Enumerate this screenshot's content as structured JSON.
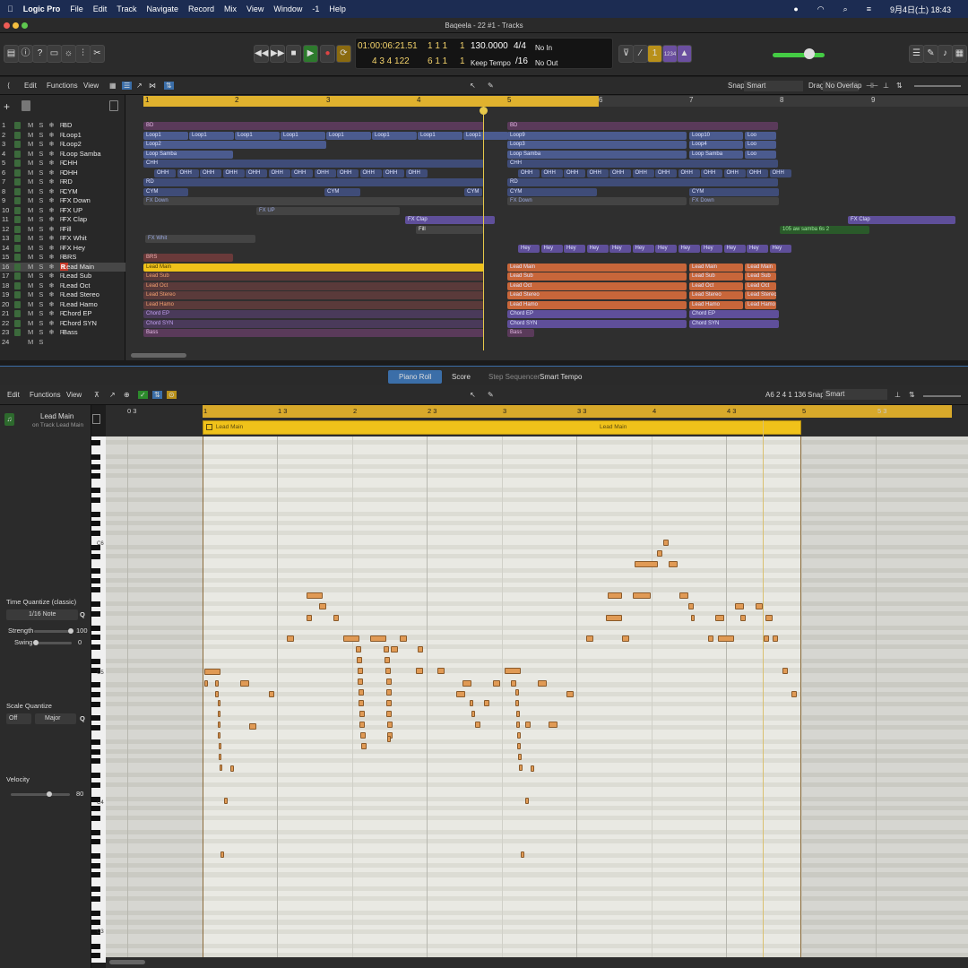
{
  "menubar": {
    "apple": "",
    "items": [
      "Logic Pro",
      "File",
      "Edit",
      "Track",
      "Navigate",
      "Record",
      "Mix",
      "View",
      "Window",
      "?1",
      "Help"
    ],
    "clock": "9月4日(土) 18:43"
  },
  "window": {
    "title": "Baqeela - 22 #1 - Tracks"
  },
  "lcd": {
    "time": "01:00:06:21.51",
    "beats_top": "1  1  1",
    "beats_top_last": "1",
    "beats_bottom": "4  3  4 122",
    "beats_bottom2": "6  1  1",
    "beats_bottom_last": "1",
    "tempo": "130.0000",
    "tempo_mode": "Keep Tempo",
    "signature": "4/4",
    "division": "/16",
    "in": "No In",
    "out": "No Out"
  },
  "tracks_toolbar": {
    "edit": "Edit",
    "functions": "Functions",
    "view": "View",
    "snap_label": "Snap:",
    "snap_value": "Smart",
    "drag_label": "Drag:",
    "drag_value": "No Overlap"
  },
  "ruler_bars": [
    "1",
    "2",
    "3",
    "4",
    "5",
    "6",
    "7",
    "8",
    "9"
  ],
  "tracks": [
    {
      "num": "1",
      "name": "BD"
    },
    {
      "num": "2",
      "name": "Loop1"
    },
    {
      "num": "3",
      "name": "Loop2"
    },
    {
      "num": "4",
      "name": "Loop Samba"
    },
    {
      "num": "5",
      "name": "CHH"
    },
    {
      "num": "6",
      "name": "OHH"
    },
    {
      "num": "7",
      "name": "RD"
    },
    {
      "num": "8",
      "name": "CYM"
    },
    {
      "num": "9",
      "name": "FX Down"
    },
    {
      "num": "10",
      "name": "FX UP"
    },
    {
      "num": "11",
      "name": "FX Clap"
    },
    {
      "num": "12",
      "name": "Fill"
    },
    {
      "num": "13",
      "name": "FX Whit"
    },
    {
      "num": "14",
      "name": "FX Hey"
    },
    {
      "num": "15",
      "name": "BRS"
    },
    {
      "num": "16",
      "name": "Lead Main"
    },
    {
      "num": "17",
      "name": "Lead Sub"
    },
    {
      "num": "18",
      "name": "Lead Oct"
    },
    {
      "num": "19",
      "name": "Lead Stereo"
    },
    {
      "num": "20",
      "name": "Lead Hamo"
    },
    {
      "num": "21",
      "name": "Chord EP"
    },
    {
      "num": "22",
      "name": "Chord SYN"
    },
    {
      "num": "23",
      "name": "Bass"
    },
    {
      "num": "24",
      "name": ""
    }
  ],
  "region_labels": {
    "bd": "BD",
    "loop1": "Loop1",
    "loop2": "Loop2",
    "samba": "Loop Samba",
    "chh": "CHH",
    "ohh": "OHH",
    "rd": "RD",
    "cym": "CYM",
    "fxdown": "FX Down",
    "fxup": "FX UP",
    "fxclap": "FX Clap",
    "fill": "Fill",
    "fxwhit": "FX Whit",
    "hey": "Hey",
    "brs": "BRS",
    "leadmain": "Lead Main",
    "leadsub": "Lead Sub",
    "leadoct": "Lead Oct",
    "leadstereo": "Lead Stereo",
    "leadhamo": "Lead Hamo",
    "chordep": "Chord EP",
    "chordsyn": "Chord SYN",
    "bass": "Bass",
    "samba2": "105 aw samba 6s 2",
    "loop9": "Loop9",
    "loop10": "Loop10",
    "loop3": "Loop3",
    "loop4": "Loop4",
    "loo": "Loo"
  },
  "editor_tabs": [
    "Piano Roll",
    "Score",
    "Step Sequencer",
    "Smart Tempo"
  ],
  "piano_roll": {
    "edit": "Edit",
    "functions": "Functions",
    "view": "View",
    "position": "A6  2 4 1 136",
    "snap_label": "Snap:",
    "snap_value": "Smart",
    "ruler": [
      "0 3",
      "1",
      "1 3",
      "2",
      "2 3",
      "3",
      "3 3",
      "4",
      "4 3",
      "5",
      "5 3"
    ],
    "region_name": "Lead Main",
    "region_name2": "Lead Main",
    "key_labels": [
      "C6",
      "C5",
      "C4",
      "C3"
    ]
  },
  "inspector": {
    "region_title": "Lead Main",
    "region_sub": "on Track Lead Main",
    "time_quantize_label": "Time Quantize (classic)",
    "time_quantize_value": "1/16 Note",
    "strength_label": "Strength",
    "strength_value": "100",
    "swing_label": "Swing",
    "swing_value": "0",
    "scale_quantize_label": "Scale Quantize",
    "scale_off": "Off",
    "scale_mode": "Major",
    "velocity_label": "Velocity",
    "velocity_value": "80",
    "q": "Q"
  },
  "colors": {
    "accent": "#f0c21a",
    "region_blue": "#4a5ea0",
    "region_orange": "#c8663a",
    "note": "#e09a55",
    "selected_track": "#f0c21a"
  }
}
